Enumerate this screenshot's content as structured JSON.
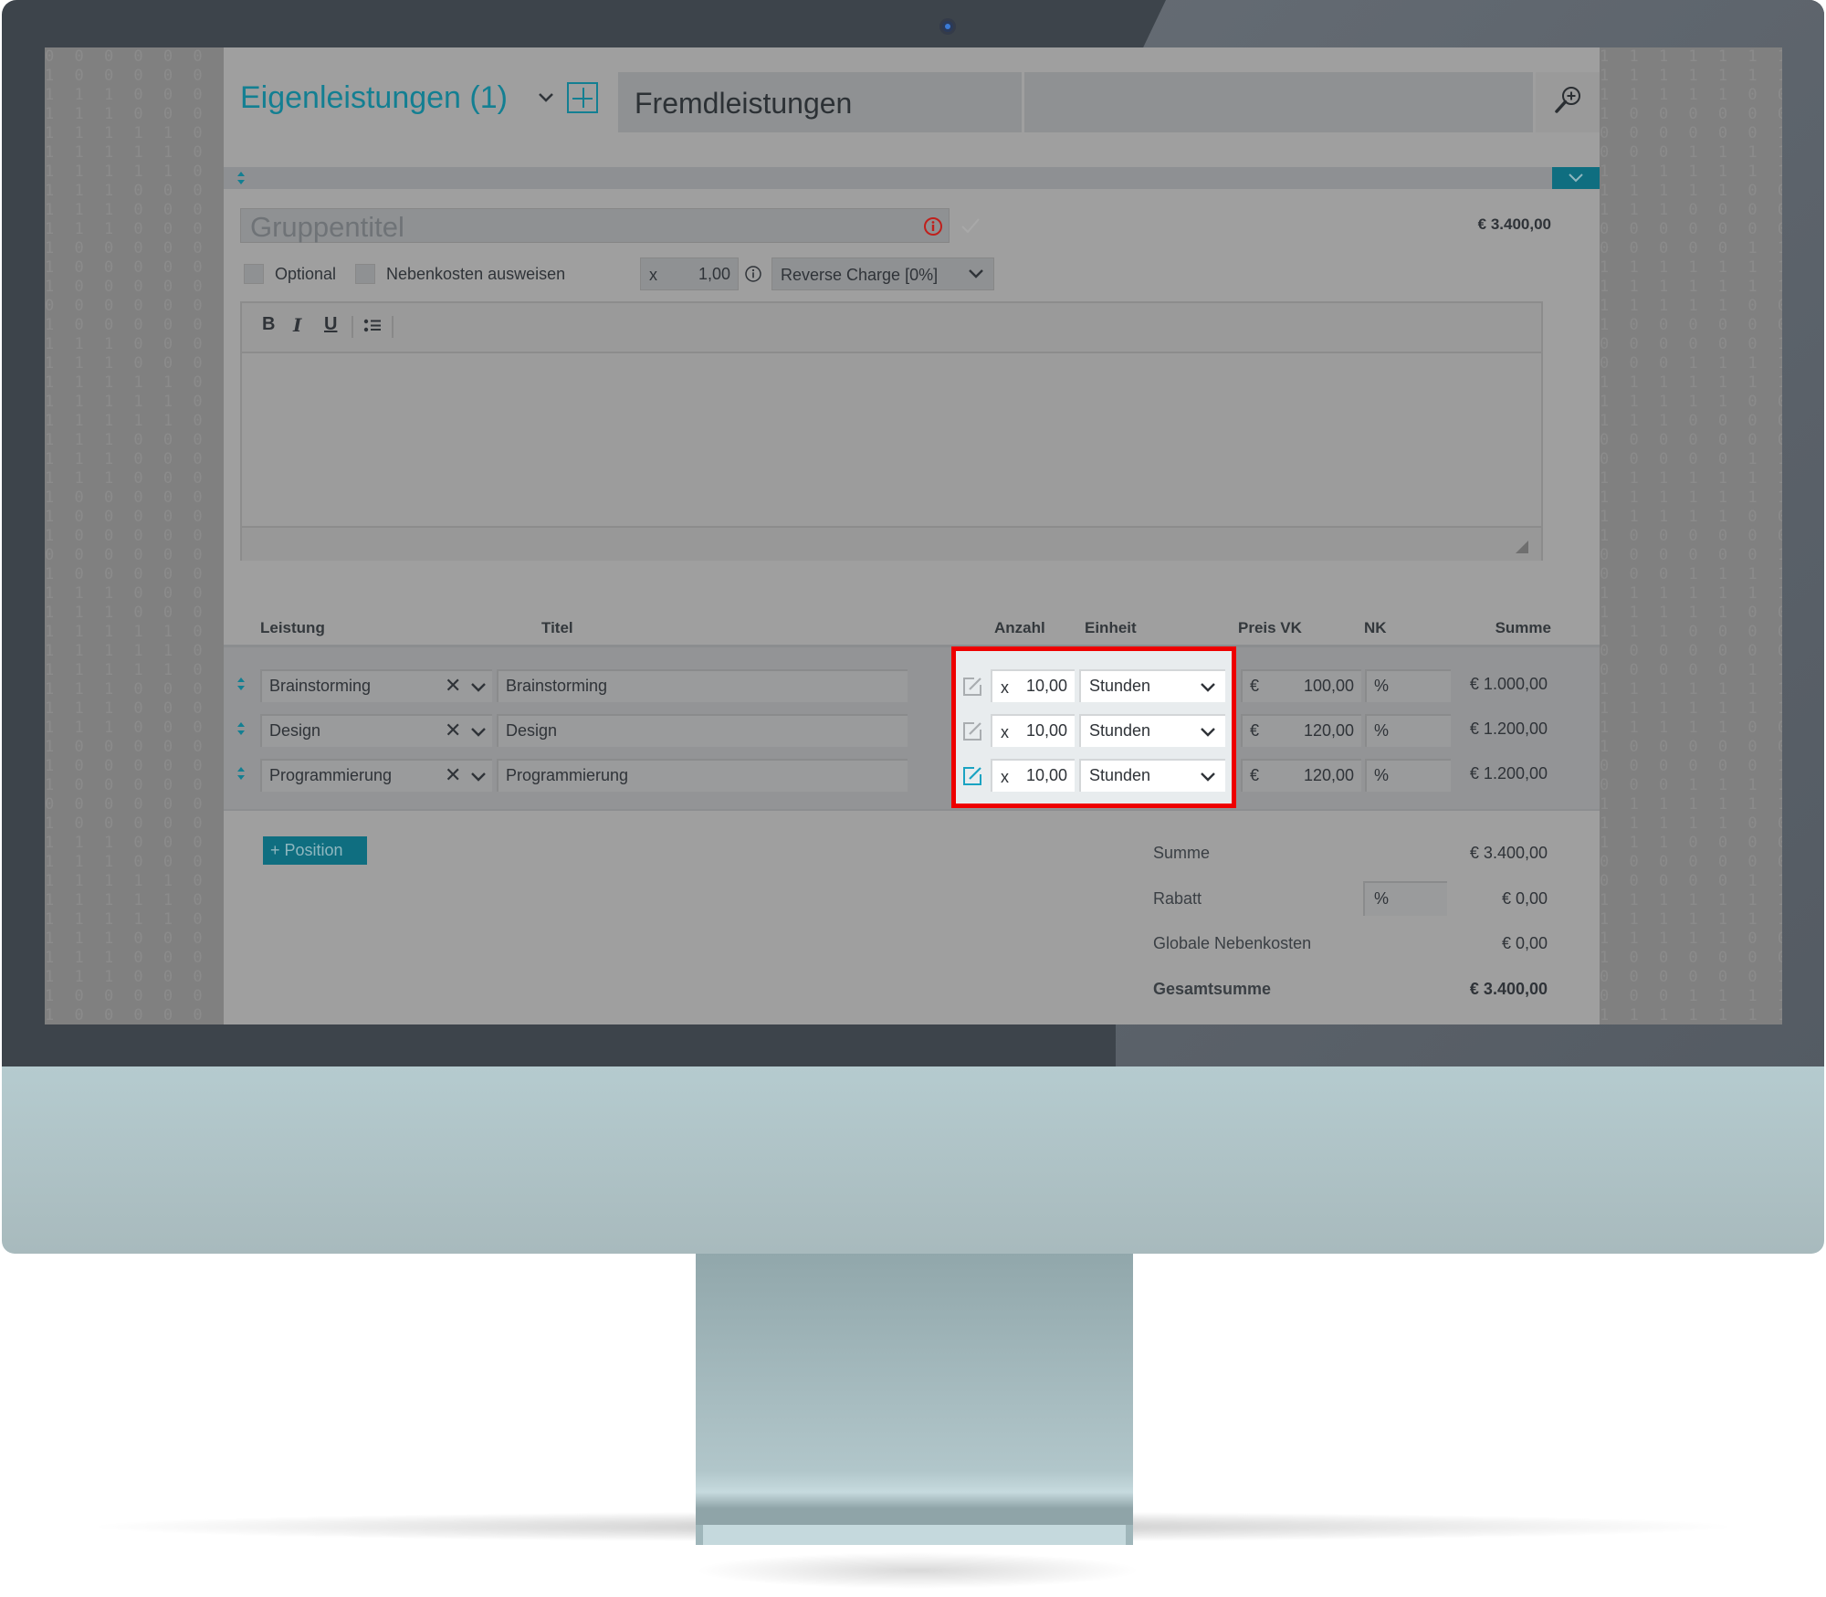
{
  "device": {
    "camera_icon": "webcam"
  },
  "header": {
    "tabs": [
      {
        "label": "Eigenleistungen (1)",
        "active": true
      },
      {
        "label": "Fremdleistungen",
        "active": false
      }
    ],
    "add_tab_icon": "plus-square",
    "search_icon": "zoom-in-magnifier"
  },
  "group": {
    "title_placeholder": "Gruppentitel",
    "total": "€ 3.400,00",
    "options": {
      "optional_label": "Optional",
      "optional_checked": false,
      "nebenkosten_label": "Nebenkosten ausweisen",
      "nebenkosten_checked": false,
      "multiplier_prefix": "x",
      "multiplier_value": "1,00",
      "tax_selected": "Reverse Charge [0%]"
    },
    "editor": {
      "toolbar": [
        "B",
        "I",
        "U",
        "bullet-list"
      ],
      "content": ""
    }
  },
  "table": {
    "columns": [
      "Leistung",
      "Titel",
      "Anzahl",
      "Einheit",
      "Preis VK",
      "NK",
      "Summe"
    ],
    "rows": [
      {
        "leistung": "Brainstorming",
        "titel": "Brainstorming",
        "edit_active": false,
        "anzahl_prefix": "x",
        "anzahl": "10,00",
        "einheit": "Stunden",
        "currency": "€",
        "preis": "100,00",
        "nk": "%",
        "summe": "€ 1.000,00"
      },
      {
        "leistung": "Design",
        "titel": "Design",
        "edit_active": false,
        "anzahl_prefix": "x",
        "anzahl": "10,00",
        "einheit": "Stunden",
        "currency": "€",
        "preis": "120,00",
        "nk": "%",
        "summe": "€ 1.200,00"
      },
      {
        "leistung": "Programmierung",
        "titel": "Programmierung",
        "edit_active": true,
        "anzahl_prefix": "x",
        "anzahl": "10,00",
        "einheit": "Stunden",
        "currency": "€",
        "preis": "120,00",
        "nk": "%",
        "summe": "€ 1.200,00"
      }
    ],
    "clear_glyph": "✕"
  },
  "actions": {
    "add_position": "+ Position"
  },
  "summary": {
    "summe_label": "Summe",
    "summe_value": "€ 3.400,00",
    "rabatt_label": "Rabatt",
    "rabatt_unit": "%",
    "rabatt_value": "€ 0,00",
    "nebenkosten_label": "Globale Nebenkosten",
    "nebenkosten_value": "€ 0,00",
    "gesamt_label": "Gesamtsumme",
    "gesamt_value": "€ 3.400,00"
  },
  "colors": {
    "accent": "#137f92",
    "accent_dark": "#0f6e80",
    "highlight_border": "#ee0000",
    "error": "#c0201c",
    "edit_active": "#1aa3c2"
  }
}
